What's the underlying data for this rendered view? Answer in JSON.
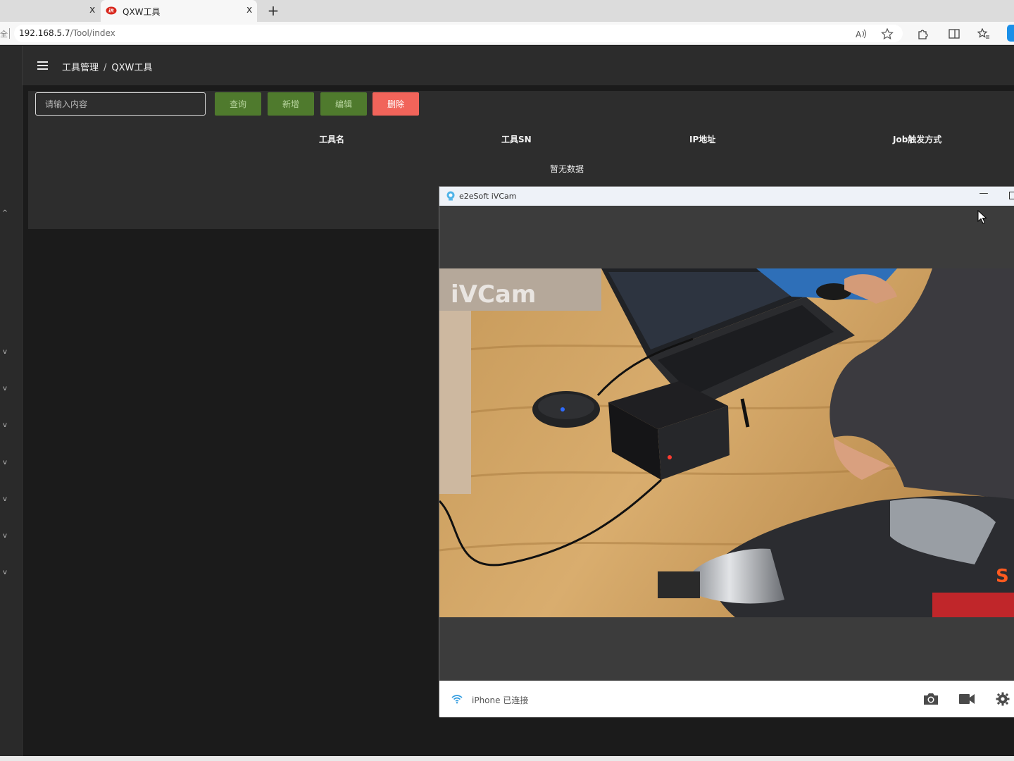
{
  "browser": {
    "tabs": [
      {
        "label": "",
        "close": "x"
      },
      {
        "label": "QXW工具",
        "close": "x",
        "favicon": "ir-brand-icon"
      }
    ],
    "new_tab": "+",
    "address_lead": "全",
    "url_host": "192.168.5.7",
    "url_path": "/Tool/index",
    "toolbar_icons": [
      "read-aloud-icon",
      "favorite-star-icon",
      "extensions-icon",
      "split-screen-icon",
      "favorites-icon"
    ],
    "accent_color": "#1b8fe8"
  },
  "app": {
    "breadcrumb": {
      "parent": "工具管理",
      "separator": "/",
      "current": "QXW工具"
    },
    "search": {
      "placeholder": "请输入内容",
      "value": ""
    },
    "buttons": {
      "query": "查询",
      "add": "新增",
      "edit": "编辑",
      "delete": "删除"
    },
    "table": {
      "columns": [
        "工具名",
        "工具SN",
        "IP地址",
        "Job触发方式"
      ],
      "empty_text": "暂无数据"
    },
    "rail_arrows": [
      "^",
      "v",
      "v",
      "v",
      "v",
      "v",
      "v",
      "v"
    ],
    "colors": {
      "button_green": "#4f7a2d",
      "button_red": "#f1645a"
    }
  },
  "ivcam": {
    "title": "e2eSoft iVCam",
    "minimize": "—",
    "watermark": "iVCam",
    "status": "iPhone 已连接",
    "status_icons": [
      "camera-snapshot-icon",
      "video-record-icon",
      "settings-gear-icon"
    ]
  }
}
